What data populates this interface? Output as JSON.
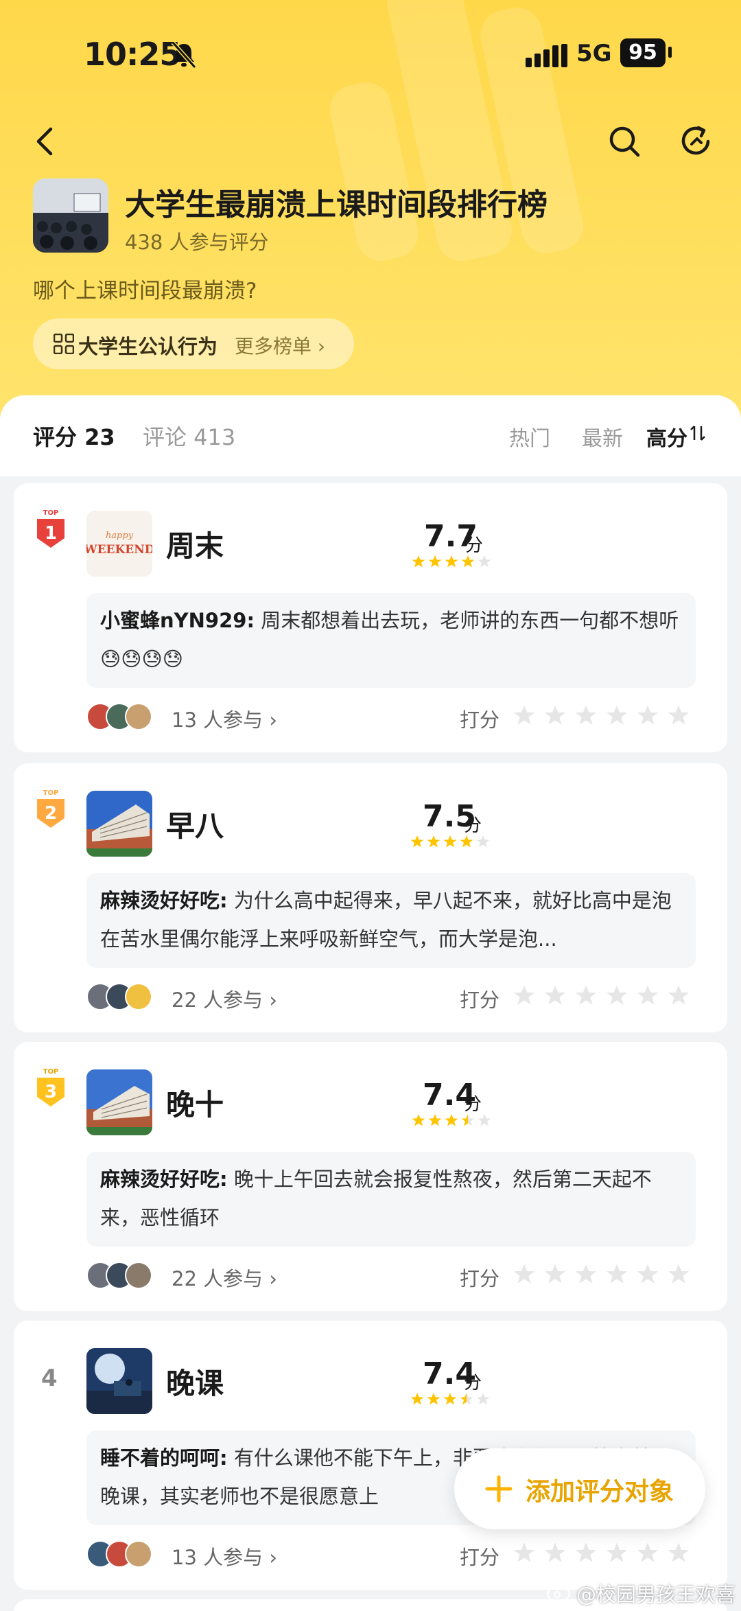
{
  "status_bar": {
    "time": "10:25",
    "network": "5G",
    "battery": "95"
  },
  "header": {
    "title": "大学生最崩溃上课时间段排行榜",
    "participants": "438 人参与评分",
    "question": "哪个上课时间段最崩溃?",
    "chip_label": "大学生公认行为",
    "chip_more": "更多榜单 ›"
  },
  "tabs": {
    "score": "评分 23",
    "comments": "评论 413",
    "sort_hot": "热门",
    "sort_new": "最新",
    "sort_high": "高分"
  },
  "items": [
    {
      "rank_badge": "TOP",
      "rank": "1",
      "thumb_text": "happy WEEKEND",
      "name": "周末",
      "score": "7.7",
      "unit": "分",
      "stars": 4,
      "comment_user": "小蜜蜂nYN929:",
      "comment_text": "周末都想着出去玩，老师讲的东西一句都不想听😓😓😓😓",
      "participants": "13 人参与 ›",
      "rate_label": "打分"
    },
    {
      "rank_badge": "TOP",
      "rank": "2",
      "name": "早八",
      "score": "7.5",
      "unit": "分",
      "stars": 4,
      "comment_user": "麻辣烫好好吃:",
      "comment_text": "为什么高中起得来，早八起不来，就好比高中是泡在苦水里偶尔能浮上来呼吸新鲜空气，而大学是泡...",
      "participants": "22 人参与 ›",
      "rate_label": "打分"
    },
    {
      "rank_badge": "TOP",
      "rank": "3",
      "name": "晚十",
      "score": "7.4",
      "unit": "分",
      "stars": 3.5,
      "comment_user": "麻辣烫好好吃:",
      "comment_text": "晚十上午回去就会报复性熬夜，然后第二天起不来，恶性循环",
      "participants": "22 人参与 ›",
      "rate_label": "打分"
    },
    {
      "rank": "4",
      "name": "晚课",
      "score": "7.4",
      "unit": "分",
      "stars": 3.5,
      "comment_user": "睡不着的呵呵:",
      "comment_text": "有什么课他不能下午上，非要晚上上呢，答案就是晚课，其实老师也不是很愿意上",
      "participants": "13 人参与 ›",
      "rate_label": "打分"
    }
  ],
  "fab_label": "添加评分对象",
  "watermark": "@校园男孩王欢喜",
  "colors": {
    "accent": "#ffd84a",
    "star": "#ffc400",
    "badge_red": "#e8413c",
    "badge_orange": "#ffa940",
    "badge_yellow": "#ffc21f"
  }
}
